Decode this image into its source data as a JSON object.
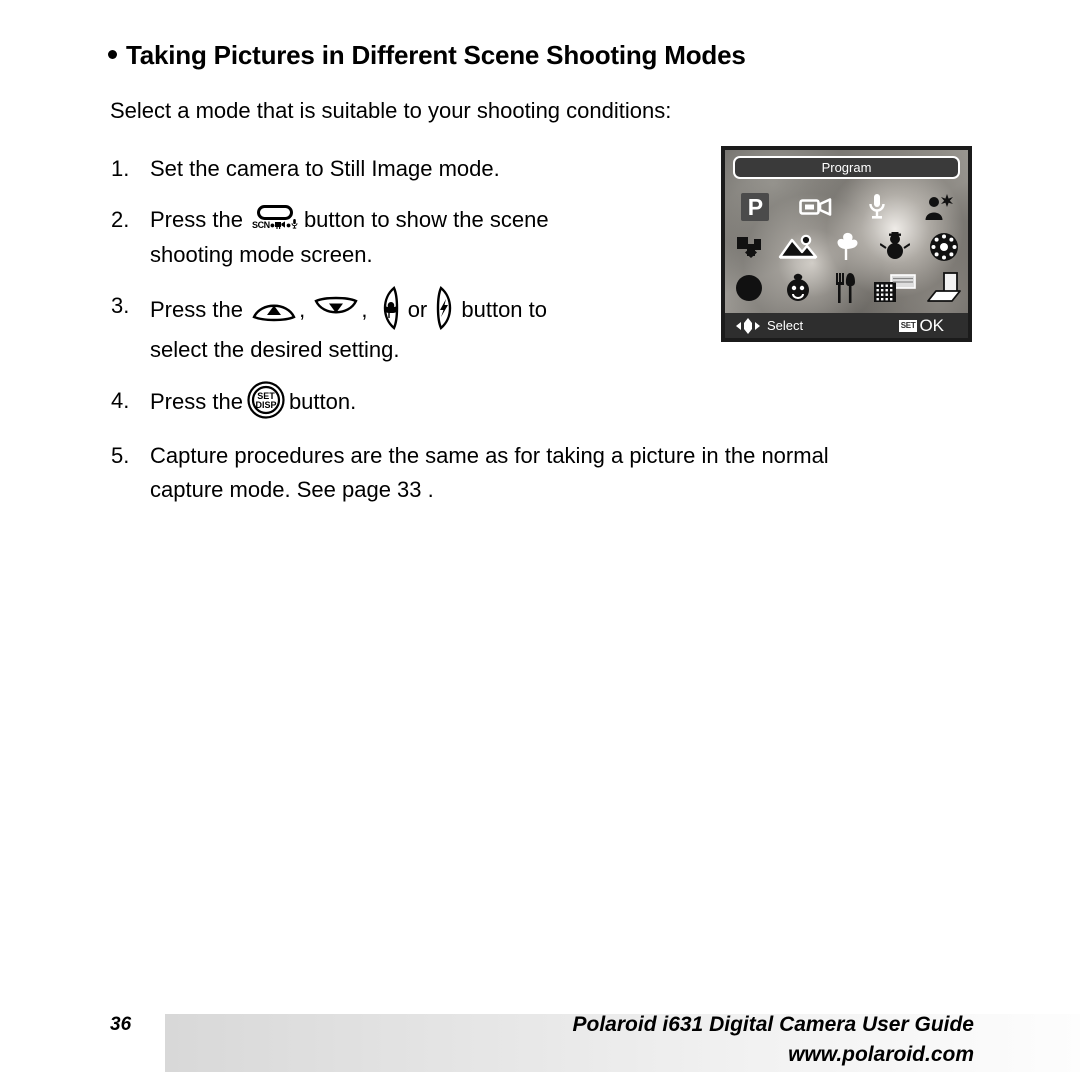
{
  "heading": {
    "bullet": "bullet-dot",
    "text": "Taking Pictures in Different Scene Shooting Modes"
  },
  "intro": "Select a mode that is suitable to your shooting conditions:",
  "steps": [
    {
      "number": "1.",
      "line1_before": "Set the camera to Still Image mode.",
      "line1_after": "",
      "line2": ""
    },
    {
      "number": "2.",
      "line1_before": "Press the",
      "line1_after": "button to show the scene",
      "line2": "shooting mode screen.",
      "icon": "scn-video-voice-button",
      "icon_label": "SCN"
    },
    {
      "number": "3.",
      "line1_before": "Press the",
      "sep1": ",",
      "sep2": ",",
      "or_text": "or",
      "line1_after": "button to",
      "line2": "select the desired setting.",
      "icons": [
        "up-arrow-button",
        "down-arrow-button",
        "macro-left-button",
        "flash-right-button"
      ]
    },
    {
      "number": "4.",
      "line1_before": "Press the",
      "line1_after": "button.",
      "line2": "",
      "icon": "set-disp-button",
      "icon_label_top": "SET",
      "icon_label_bottom": "DISP"
    },
    {
      "number": "5.",
      "line1_before": "Capture procedures are the same as for taking a picture in the normal",
      "line1_after": "",
      "line2": "capture mode. See page  33 ."
    }
  ],
  "lcd": {
    "title": "Program",
    "selected_mode": "P",
    "rows": [
      [
        {
          "icon": "program-mode-icon",
          "label": "P",
          "selected": true
        },
        {
          "icon": "video-camera-icon",
          "label": ""
        },
        {
          "icon": "microphone-icon",
          "label": ""
        },
        {
          "icon": "night-portrait-icon",
          "label": ""
        }
      ],
      [
        {
          "icon": "sports-mode-icon",
          "label": ""
        },
        {
          "icon": "landscape-icon",
          "label": ""
        },
        {
          "icon": "macro-flower-icon",
          "label": ""
        },
        {
          "icon": "snow-snowman-icon",
          "label": ""
        },
        {
          "icon": "fireworks-icon",
          "label": ""
        }
      ],
      [
        {
          "icon": "night-moon-icon",
          "label": ""
        },
        {
          "icon": "children-icon",
          "label": ""
        },
        {
          "icon": "food-icon",
          "label": ""
        },
        {
          "icon": "building-night-icon",
          "label": ""
        },
        {
          "icon": "text-document-icon",
          "label": ""
        }
      ]
    ],
    "bottom": {
      "select_icon": "four-way-arrow-icon",
      "select_label": "Select",
      "set_badge": "SET",
      "ok_label": "OK"
    }
  },
  "footer": {
    "page_number": "36",
    "guide_title": "Polaroid i631 Digital Camera User Guide",
    "url": "www.polaroid.com"
  },
  "colors": {
    "text": "#000000",
    "lcd_panel": "#3a3a3a",
    "lcd_bottom_bar": "#2e2e2e",
    "lcd_frame": "#1b1b1b",
    "footer_band_start": "#d8d8d8",
    "footer_band_end": "#fdfdfd"
  }
}
